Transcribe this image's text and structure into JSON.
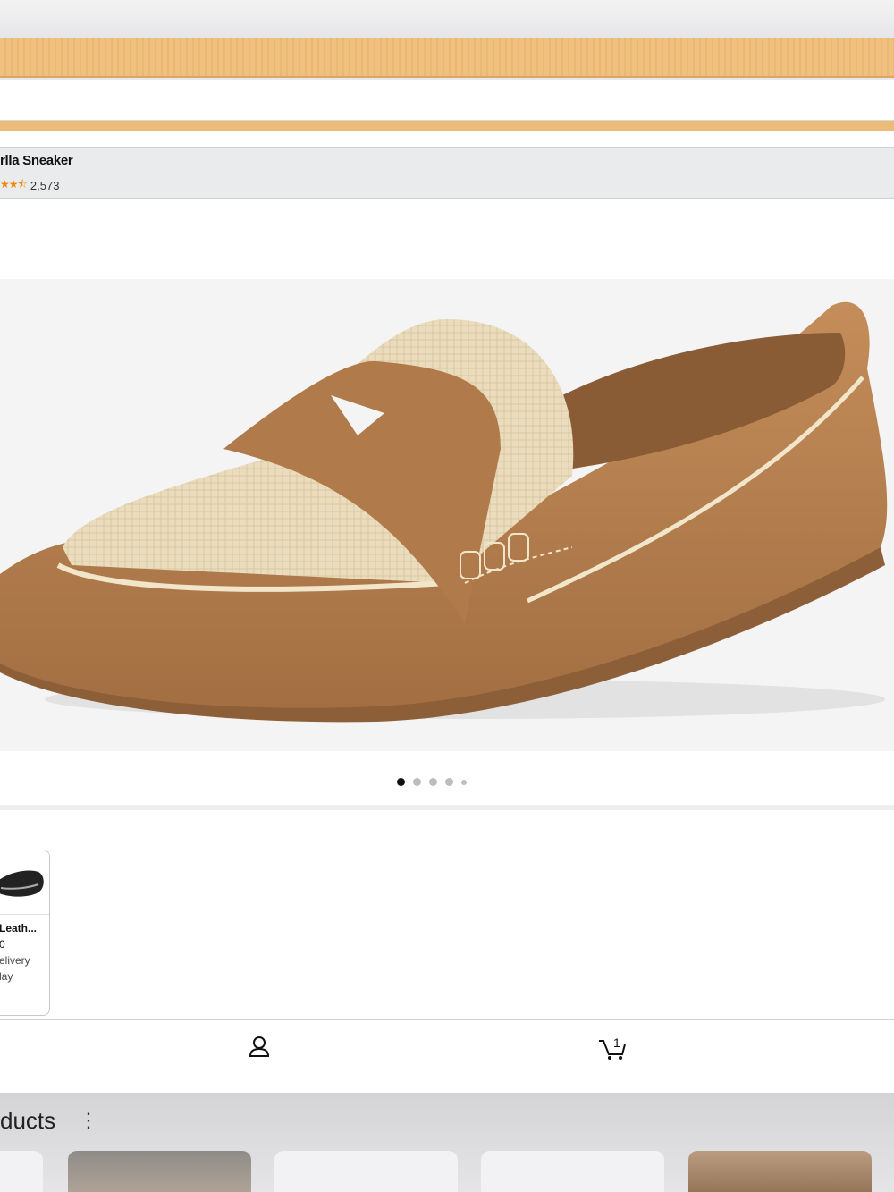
{
  "search": {
    "placeholder": ""
  },
  "product": {
    "title": "rlla Sneaker",
    "stars": "★★⯪",
    "rating_count": "2,573",
    "image_count": 5,
    "active_image_index": 0
  },
  "related": {
    "cards": [
      {
        "title": "Leath...",
        "price": "0",
        "badge": "",
        "delivery": "elivery",
        "day": "lay"
      }
    ]
  },
  "bottom_nav": {
    "items": [
      {
        "icon": "account-icon"
      },
      {
        "icon": "cart-icon",
        "badge": "1"
      }
    ]
  },
  "panel": {
    "title": "ducts",
    "menu": "⋮"
  },
  "colors": {
    "accent": "#f0c07e",
    "leather": "#b7814f",
    "raffia": "#eadcbd",
    "star": "#f08804"
  }
}
